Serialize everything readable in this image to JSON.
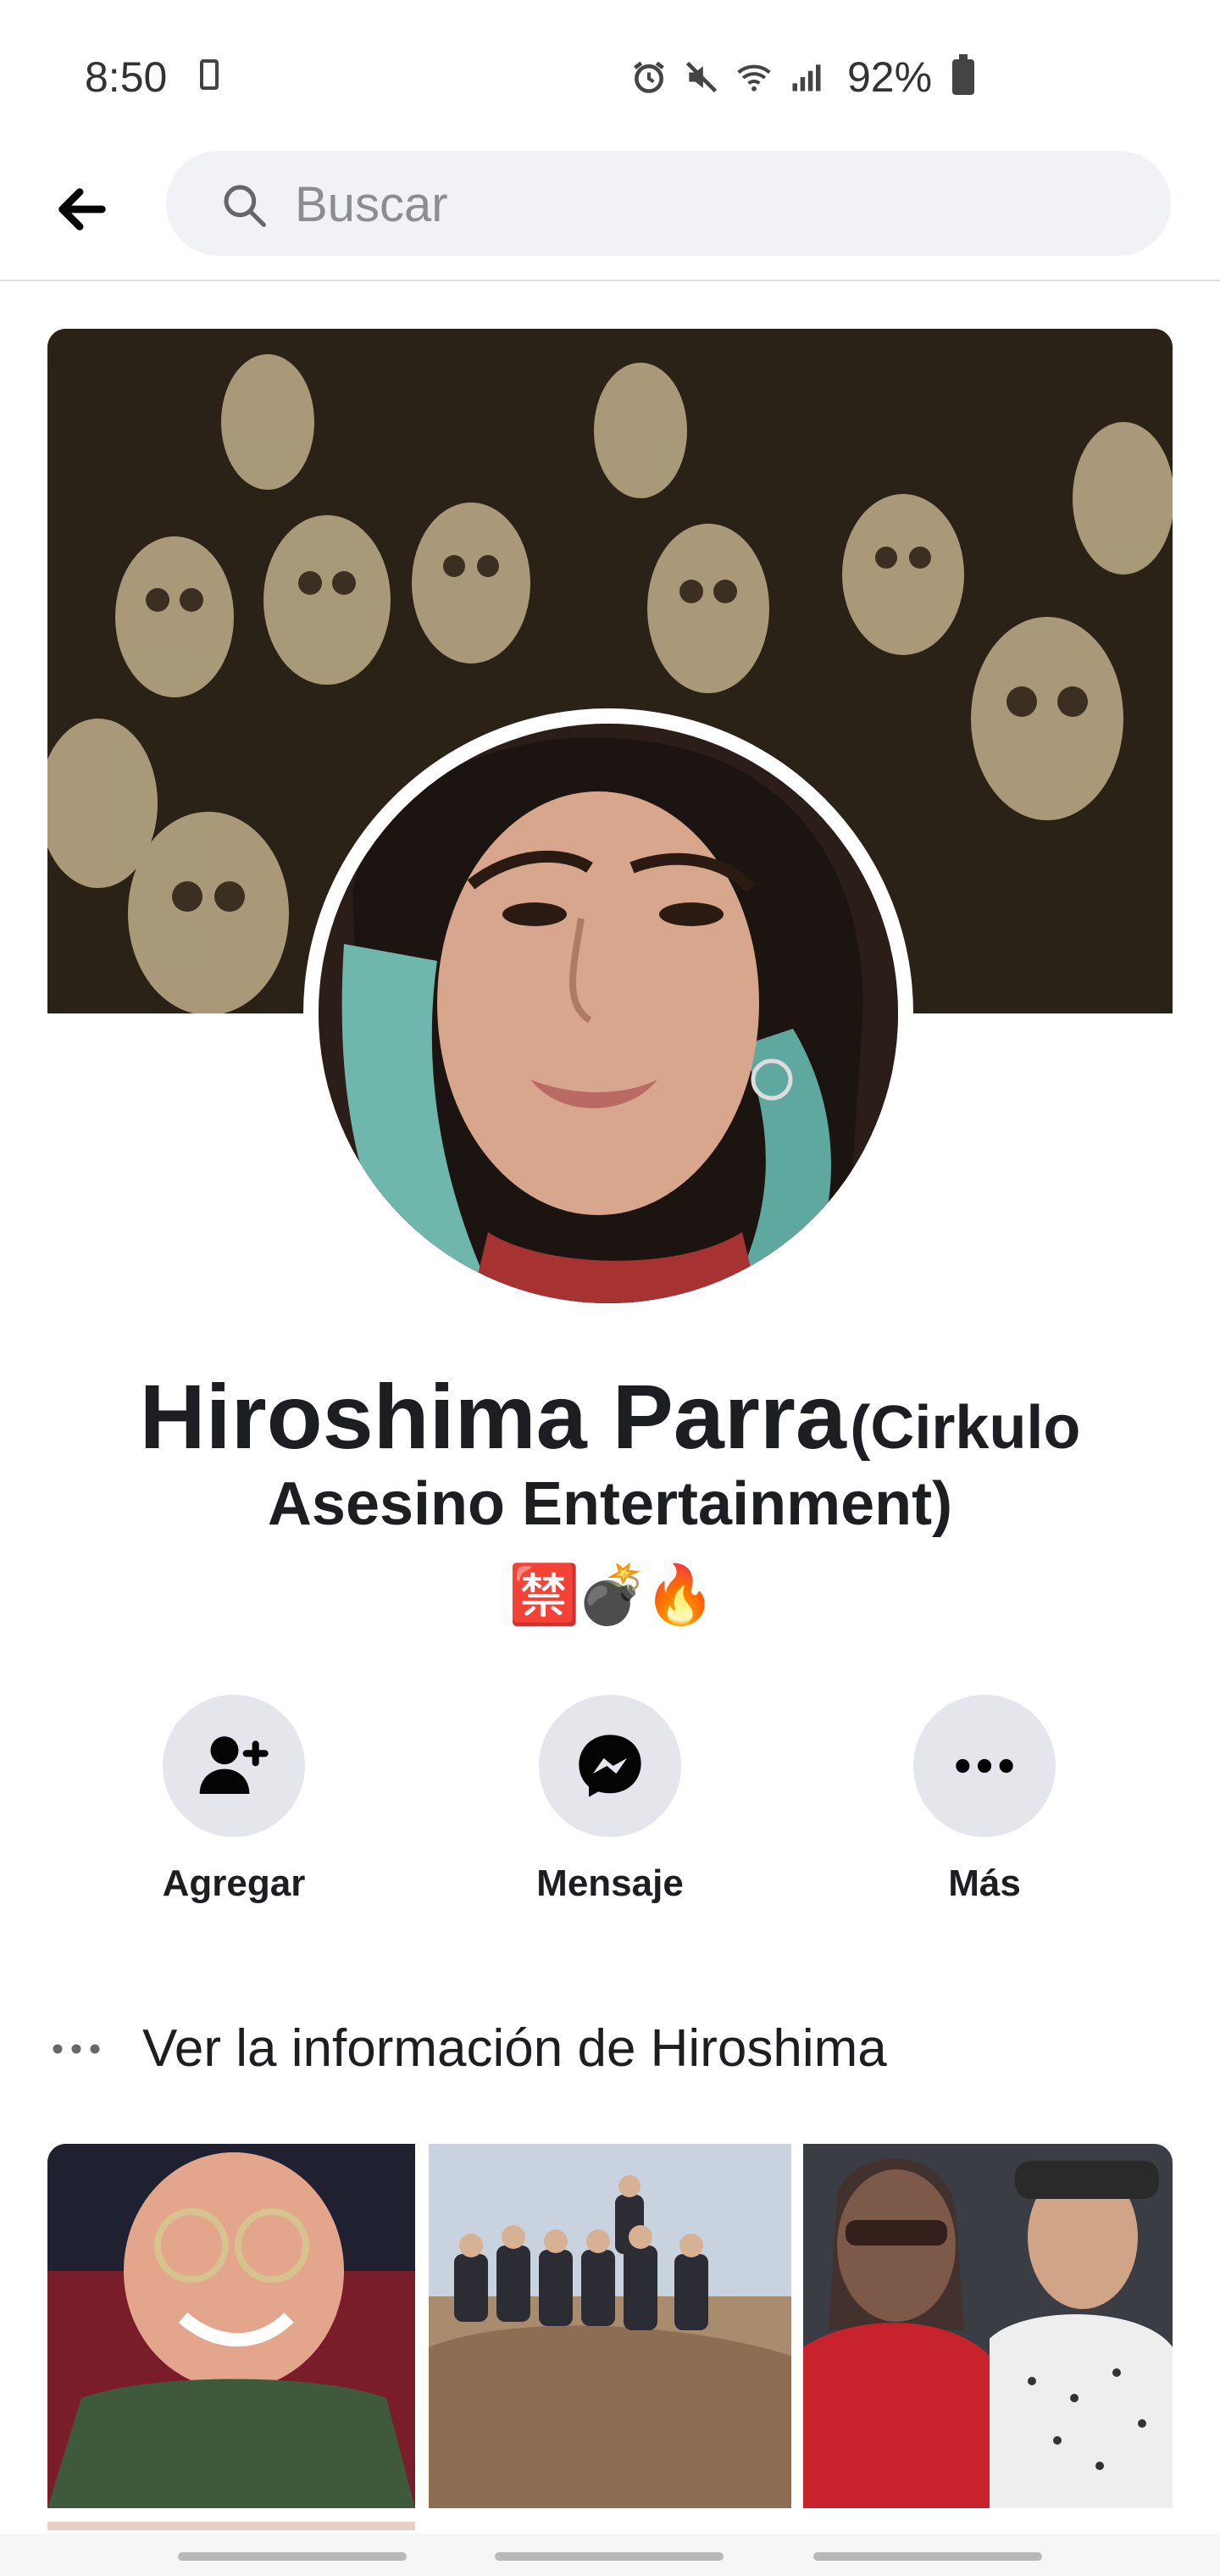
{
  "status_bar": {
    "time": "8:50",
    "battery": "92%",
    "icons": [
      "sim-card-icon",
      "alarm-icon",
      "mute-icon",
      "wifi-icon",
      "signal-icon",
      "battery-icon"
    ]
  },
  "header": {
    "back_icon": "back-arrow-icon",
    "search_placeholder": "Buscar"
  },
  "profile": {
    "name": "Hiroshima Parra",
    "alternate_name": "(Cirkulo Asesino Entertainment)",
    "bio_emojis": [
      "🈲",
      "💣",
      "🔥"
    ],
    "cover_description_hidden": true
  },
  "actions": [
    {
      "label": "Agregar",
      "icon": "add-friend-icon"
    },
    {
      "label": "Mensaje",
      "icon": "messenger-icon"
    },
    {
      "label": "Más",
      "icon": "more-icon"
    }
  ],
  "info": {
    "label": "Ver la información de Hiroshima",
    "icon": "more-dots-icon"
  },
  "colors": {
    "background": "#ffffff",
    "search_bg": "#f0f2f5",
    "action_circle": "#e4e6eb",
    "text": "#1c1e21"
  }
}
